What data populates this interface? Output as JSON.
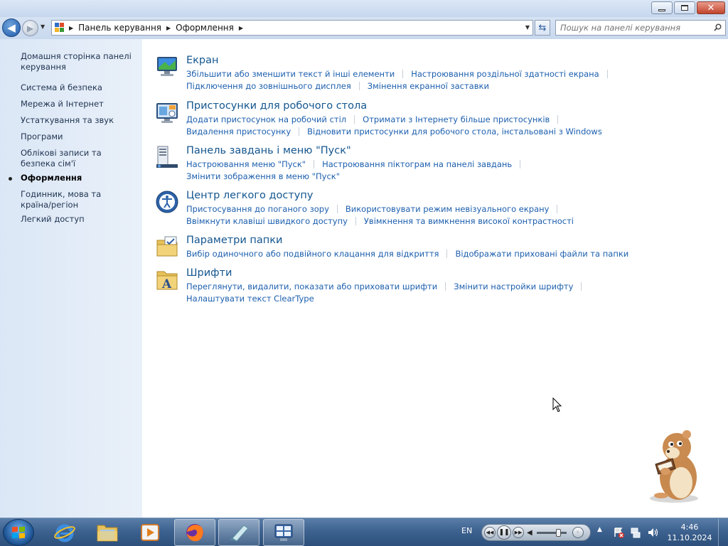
{
  "window": {
    "address": {
      "crumbs": [
        "Панель керування",
        "Оформлення"
      ]
    },
    "search_placeholder": "Пошук на панелі керування"
  },
  "sidebar": {
    "items": [
      {
        "label": "Домашня сторінка панелі керування",
        "current": false
      },
      {
        "label": "Система й безпека",
        "current": false
      },
      {
        "label": "Мережа й Інтернет",
        "current": false
      },
      {
        "label": "Устаткування та звук",
        "current": false
      },
      {
        "label": "Програми",
        "current": false
      },
      {
        "label": "Облікові записи та безпека сім'ї",
        "current": false
      },
      {
        "label": "Оформлення",
        "current": true
      },
      {
        "label": "Годинник, мова та країна/регіон",
        "current": false
      },
      {
        "label": "Легкий доступ",
        "current": false
      }
    ]
  },
  "categories": [
    {
      "title": "Екран",
      "icon": "display-icon",
      "rows": [
        [
          "Збільшити або зменшити текст й інші елементи",
          "Настроювання роздільної здатності екрана"
        ],
        [
          "Підключення до зовнішнього дисплея",
          "Змінення екранної заставки"
        ]
      ]
    },
    {
      "title": "Пристосунки для робочого стола",
      "icon": "gadgets-icon",
      "rows": [
        [
          "Додати пристосунок на робочий стіл",
          "Отримати з Інтернету більше пристосунків"
        ],
        [
          "Видалення пристосунку",
          "Відновити пристосунки для робочого стола, інстальовані з Windows"
        ]
      ]
    },
    {
      "title": "Панель завдань і меню \"Пуск\"",
      "icon": "taskbar-icon",
      "rows": [
        [
          "Настроювання меню \"Пуск\"",
          "Настроювання піктограм на панелі завдань"
        ],
        [
          "Змінити зображення в меню \"Пуск\""
        ]
      ]
    },
    {
      "title": "Центр легкого доступу",
      "icon": "ease-of-access-icon",
      "rows": [
        [
          "Пристосування до поганого зору",
          "Використовувати режим невізуального екрану"
        ],
        [
          "Ввімкнути клавіші швидкого доступу",
          "Увімкнення та вимкнення високої контрастності"
        ]
      ]
    },
    {
      "title": "Параметри папки",
      "icon": "folder-options-icon",
      "rows": [
        [
          "Вибір одиночного або подвійного клацання для відкриття",
          "Відображати приховані файли та папки"
        ]
      ]
    },
    {
      "title": "Шрифти",
      "icon": "fonts-icon",
      "rows": [
        [
          "Переглянути, видалити, показати або приховати шрифти",
          "Змінити настройки шрифту"
        ],
        [
          "Налаштувати текст ClearType"
        ]
      ]
    }
  ],
  "taskbar": {
    "pinned": [
      "start-orb-icon",
      "internet-explorer-icon",
      "explorer-folder-icon",
      "media-player-icon",
      "firefox-icon",
      "gadget-app-icon",
      "control-panel-icon"
    ],
    "language": "EN",
    "volume": 0.72,
    "clock": {
      "time": "4:46",
      "date": "11.10.2024"
    }
  },
  "colors": {
    "link": "#1c5fae",
    "category_title": "#14568f",
    "sidebar_bg": "#dfe9f6"
  }
}
